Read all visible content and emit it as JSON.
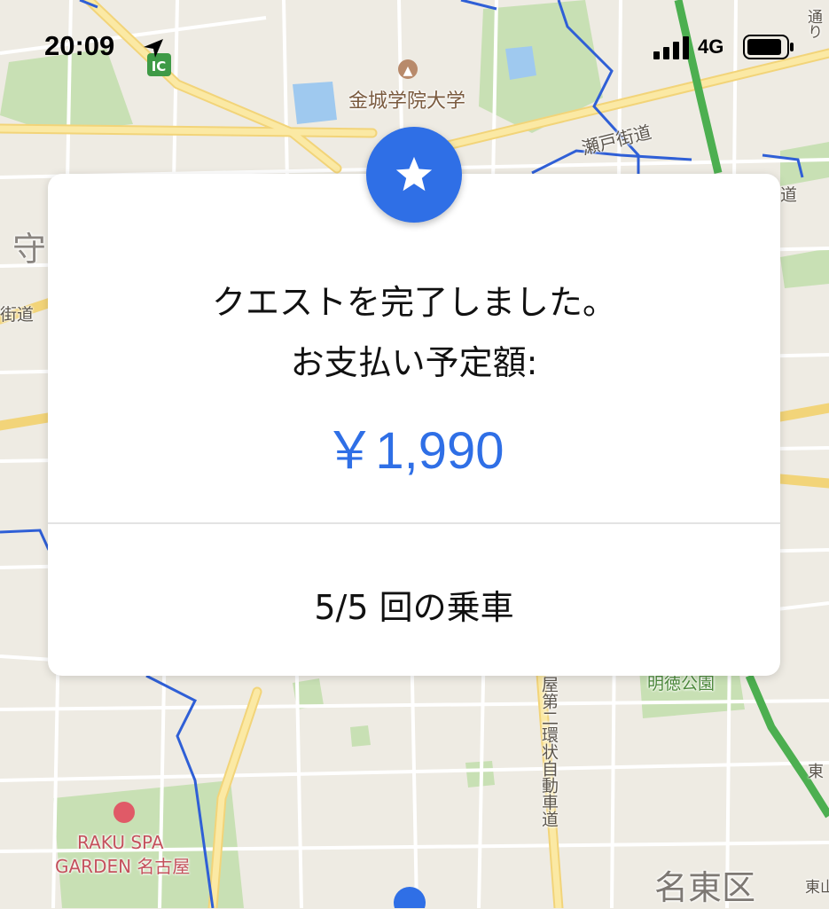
{
  "status_bar": {
    "time": "20:09",
    "network": "4G"
  },
  "map": {
    "labels": {
      "university": "金城学院大学",
      "seto_kaido": "瀬戸街道",
      "mori": "守",
      "kaido_left": "街道",
      "michi_right": "道",
      "ic": "IC",
      "raku_spa_line1": "RAKU SPA",
      "raku_spa_line2": "GARDEN 名古屋",
      "meito_ku": "名東区",
      "ring_road": "屋第二環状自動車道",
      "park": "明徳公園",
      "top_right": "通り",
      "east_partial": "東",
      "east_bottom": "東山"
    },
    "colors": {
      "background": "#eeebe3",
      "road_main": "#fbe9a4",
      "road_minor": "#ffffff",
      "expressway": "#4caf50",
      "boundary": "#2f5fd6",
      "park": "#c8e0b4",
      "water": "#9fc9ef"
    }
  },
  "dialog": {
    "icon": "star-icon",
    "line1": "クエストを完了しました。",
    "line2": "お支払い予定額:",
    "amount": "￥1,990",
    "rides": "5/5 回の乗車",
    "accent_color": "#2f6fe6"
  }
}
